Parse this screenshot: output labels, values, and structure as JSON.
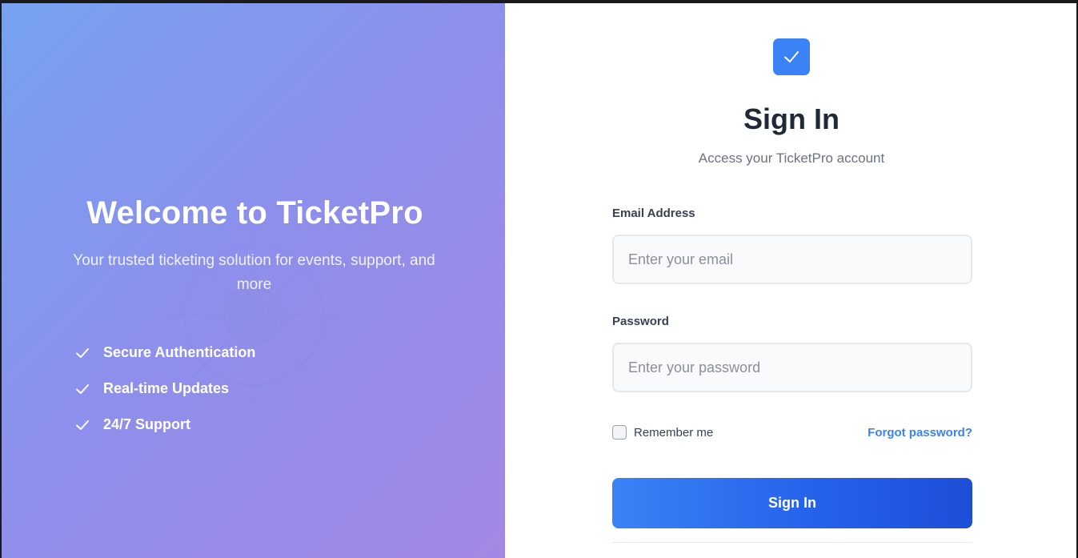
{
  "hero": {
    "title": "Welcome to TicketPro",
    "subtitle": "Your trusted ticketing solution for events, support, and more",
    "features": [
      "Secure Authentication",
      "Real-time Updates",
      "24/7 Support"
    ]
  },
  "signin": {
    "logo_icon": "check-icon",
    "title": "Sign In",
    "subtitle": "Access your TicketPro account",
    "email_label": "Email Address",
    "email_placeholder": "Enter your email",
    "email_value": "",
    "password_label": "Password",
    "password_placeholder": "Enter your password",
    "password_value": "",
    "remember_label": "Remember me",
    "remember_checked": false,
    "forgot_label": "Forgot password?",
    "submit_label": "Sign In"
  },
  "colors": {
    "accent": "#3b82f6",
    "accent_dark": "#1d4ed8",
    "gradient_start": "#76a2f0",
    "gradient_end": "#a487e4"
  }
}
